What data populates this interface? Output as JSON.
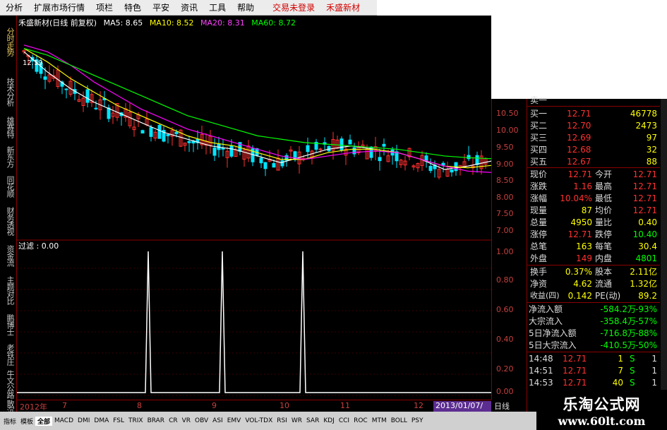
{
  "menu": [
    "分析",
    "扩展市场行情",
    "项栏",
    "特色",
    "平安",
    "资讯",
    "工具",
    "帮助"
  ],
  "menu_status": [
    "交易未登录",
    "禾盛新材"
  ],
  "left_tabs": [
    "分时走势",
    "技术分析",
    "雄赛特",
    "新东方",
    "同花顺",
    "财务透视",
    "资金流",
    "主题对比",
    "鹏博士",
    "老铁庄",
    "牛文公路",
    "散沉"
  ],
  "chart_header": {
    "stock": "禾盛新材(日线 前复权)",
    "ma5": "MA5: 8.65",
    "ma10": "MA10: 8.52",
    "ma20": "MA20: 8.31",
    "ma60": "MA60: 8.72",
    "high_marker": "12.19"
  },
  "filter_label": "过滤 : 0.00",
  "price_ticks": [
    "10.50",
    "10.00",
    "9.50",
    "9.00",
    "8.50",
    "8.00",
    "7.50",
    "7.00"
  ],
  "lower_ticks": [
    "1.00",
    "0.80",
    "0.60",
    "0.40",
    "0.20",
    "0.00"
  ],
  "time_axis": [
    "2012年",
    "7",
    "8",
    "9",
    "10",
    "11",
    "12"
  ],
  "date_box": "2013/01/07/一",
  "period": "日线",
  "quote": {
    "top_partial": "卖一",
    "bids": [
      {
        "label": "买一",
        "price": "12.71",
        "vol": "46778"
      },
      {
        "label": "买二",
        "price": "12.70",
        "vol": "2473"
      },
      {
        "label": "买三",
        "price": "12.69",
        "vol": "97"
      },
      {
        "label": "买四",
        "price": "12.68",
        "vol": "32"
      },
      {
        "label": "买五",
        "price": "12.67",
        "vol": "88"
      }
    ],
    "stats": [
      {
        "l1": "现价",
        "v1": "12.71",
        "l2": "今开",
        "v2": "12.71"
      },
      {
        "l1": "涨跌",
        "v1": "1.16",
        "l2": "最高",
        "v2": "12.71"
      },
      {
        "l1": "涨幅",
        "v1": "10.04%",
        "l2": "最低",
        "v2": "12.71"
      },
      {
        "l1": "现量",
        "v1": "87",
        "l2": "均价",
        "v2": "12.71"
      },
      {
        "l1": "总量",
        "v1": "4950",
        "l2": "量比",
        "v2": "0.40"
      },
      {
        "l1": "涨停",
        "v1": "12.71",
        "l2": "跌停",
        "v2": "10.40"
      },
      {
        "l1": "总笔",
        "v1": "163",
        "l2": "每笔",
        "v2": "30.4"
      },
      {
        "l1": "外盘",
        "v1": "149",
        "l2": "内盘",
        "v2": "4801"
      }
    ],
    "fin": [
      {
        "l1": "换手",
        "v1": "0.37%",
        "l2": "股本",
        "v2": "2.11亿"
      },
      {
        "l1": "净资",
        "v1": "4.62",
        "l2": "流通",
        "v2": "1.32亿"
      },
      {
        "l1": "收益(四)",
        "v1": "0.142",
        "l2": "PE(动)",
        "v2": "89.2"
      }
    ],
    "flows": [
      {
        "label": "净流入额",
        "value": "-584.2万",
        "pct": "-93%"
      },
      {
        "label": "大宗流入",
        "value": "-358.4万",
        "pct": "-57%"
      },
      {
        "label": "5日净流入额",
        "value": "-716.8万",
        "pct": "-88%"
      },
      {
        "label": "5日大宗流入",
        "value": "-410.5万",
        "pct": "-50%"
      }
    ],
    "ticks": [
      {
        "time": "14:48",
        "price": "12.71",
        "vol": "1",
        "side": "S",
        "n": "1"
      },
      {
        "time": "14:51",
        "price": "12.71",
        "vol": "7",
        "side": "S",
        "n": "1"
      },
      {
        "time": "14:53",
        "price": "12.71",
        "vol": "40",
        "side": "S",
        "n": "1"
      }
    ]
  },
  "bottom_tabs": [
    "指标",
    "模板",
    "全部",
    "MACD",
    "DMI",
    "DMA",
    "FSL",
    "TRIX",
    "BRAR",
    "CR",
    "VR",
    "OBV",
    "ASI",
    "EMV",
    "VOL-TDX",
    "RSI",
    "WR",
    "SAR",
    "KDJ",
    "CCI",
    "ROC",
    "MTM",
    "BOLL",
    "PSY"
  ],
  "watermark": {
    "line1": "乐淘公式网",
    "line2": "www.60lt.com"
  },
  "colors": {
    "up": "#ff3030",
    "down": "#00e5ff",
    "ma5": "#ffffff",
    "ma10": "#ffff00",
    "ma20": "#ff00ff",
    "ma60": "#00ff00",
    "panel_red": "#8b0000"
  },
  "chart_data": {
    "type": "line",
    "title": "禾盛新材(日线 前复权)",
    "series": [
      {
        "name": "MA5",
        "y": [
          11.9,
          11.3,
          10.8,
          10.4,
          10.1,
          9.8,
          9.5,
          9.3,
          9.1,
          9.0,
          8.8,
          8.6,
          8.8,
          9.0,
          9.1,
          9.0,
          8.9,
          8.7,
          8.4,
          8.5,
          8.65
        ]
      },
      {
        "name": "MA10",
        "y": [
          12.0,
          11.6,
          11.1,
          10.7,
          10.3,
          10.0,
          9.7,
          9.4,
          9.2,
          9.1,
          8.9,
          8.7,
          8.7,
          8.9,
          9.0,
          9.0,
          8.9,
          8.7,
          8.5,
          8.45,
          8.52
        ]
      },
      {
        "name": "MA20",
        "y": [
          12.1,
          11.9,
          11.5,
          11.0,
          10.6,
          10.2,
          9.9,
          9.6,
          9.4,
          9.2,
          9.0,
          8.8,
          8.7,
          8.8,
          8.9,
          8.95,
          8.9,
          8.7,
          8.5,
          8.35,
          8.31
        ]
      },
      {
        "name": "MA60",
        "y": [
          12.0,
          11.8,
          11.5,
          11.2,
          10.9,
          10.6,
          10.3,
          10.0,
          9.8,
          9.6,
          9.4,
          9.3,
          9.2,
          9.15,
          9.1,
          9.05,
          9.0,
          8.9,
          8.8,
          8.75,
          8.72
        ]
      }
    ],
    "filter_spikes": {
      "values": [
        0,
        1,
        0,
        1,
        0,
        1,
        0
      ],
      "y_range": [
        0,
        1
      ]
    }
  }
}
